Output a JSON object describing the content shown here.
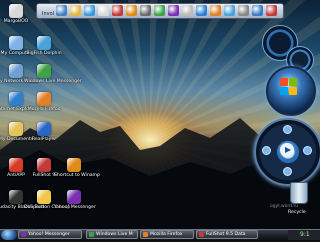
{
  "desktop_icons": [
    {
      "label": "MargoBOO",
      "color": "#d9d9d9"
    },
    {
      "label": "My Computer",
      "color": "#7fb2e6"
    },
    {
      "label": "BigFish Dolphin",
      "color": "#4aa3d8"
    },
    {
      "label": "My Network Places",
      "color": "#6ea0d0"
    },
    {
      "label": "Windows Live Messenger",
      "color": "#3fa24a"
    },
    {
      "label": "Internet Explorer",
      "color": "#2d7fd0"
    },
    {
      "label": "Mozilla Firefox",
      "color": "#e2802a"
    },
    {
      "label": "My Documents",
      "color": "#e5c25a"
    },
    {
      "label": "RealPlayer",
      "color": "#2a66c8"
    },
    {
      "label": "AntiAPP",
      "color": "#d93a2a"
    },
    {
      "label": "FullShot 9",
      "color": "#c23a3a"
    },
    {
      "label": "Shortcut to Winamp",
      "color": "#e08a1a"
    },
    {
      "label": "Audacity BlackSpeed",
      "color": "#333333"
    },
    {
      "label": "Doo Button Cleanup",
      "color": "#f2c64a"
    },
    {
      "label": "Yahoo! Messenger",
      "color": "#7b2fb3"
    }
  ],
  "toolbar": {
    "label": "Invol",
    "icons": [
      "home-icon",
      "folder-icon",
      "globe-icon",
      "mail-icon",
      "media-icon",
      "music-icon",
      "tools-icon",
      "chat-icon",
      "image-icon",
      "cd-icon",
      "search-icon",
      "firefox-icon",
      "network-icon",
      "gear-icon",
      "help-icon",
      "power-icon"
    ]
  },
  "recycle_bin": {
    "label": "Recycle"
  },
  "watermark": "ogyl.word.ru",
  "taskbar": {
    "items": [
      {
        "label": "Yahoo! Messenger",
        "color": "#7b2fb3"
      },
      {
        "label": "Windows Live M",
        "color": "#3fa24a"
      },
      {
        "label": "Mozilla Firefox",
        "color": "#e2802a"
      },
      {
        "label": "FullShot 9.5 Data",
        "color": "#c23a3a"
      }
    ],
    "clock": "9:1"
  },
  "colors": {
    "accent": "#3a7cc0",
    "taskbar": "#16191d"
  }
}
